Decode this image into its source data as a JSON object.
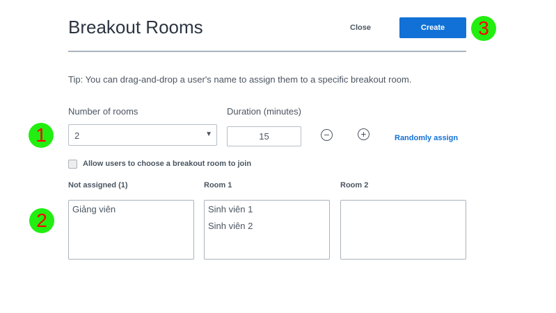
{
  "header": {
    "title": "Breakout Rooms",
    "close_label": "Close",
    "create_label": "Create"
  },
  "tip": "Tip: You can drag-and-drop a user's name to assign them to a specific breakout room.",
  "settings": {
    "rooms_label": "Number of rooms",
    "rooms_value": "2",
    "duration_label": "Duration (minutes)",
    "duration_value": "15",
    "decrement": "−",
    "increment": "+",
    "random_label": "Randomly assign",
    "allow_choose_label": "Allow users to choose a breakout room to join",
    "allow_choose_checked": false
  },
  "columns": [
    {
      "header": "Not assigned (1)",
      "users": [
        "Giảng viên"
      ]
    },
    {
      "header": "Room 1",
      "users": [
        "Sinh viên 1",
        "Sinh viên 2"
      ]
    },
    {
      "header": "Room 2",
      "users": []
    }
  ],
  "annotations": [
    "1",
    "2",
    "3"
  ],
  "colors": {
    "accent": "#1271d6",
    "marker": "#22ee11",
    "marker_text": "#ff0000"
  }
}
